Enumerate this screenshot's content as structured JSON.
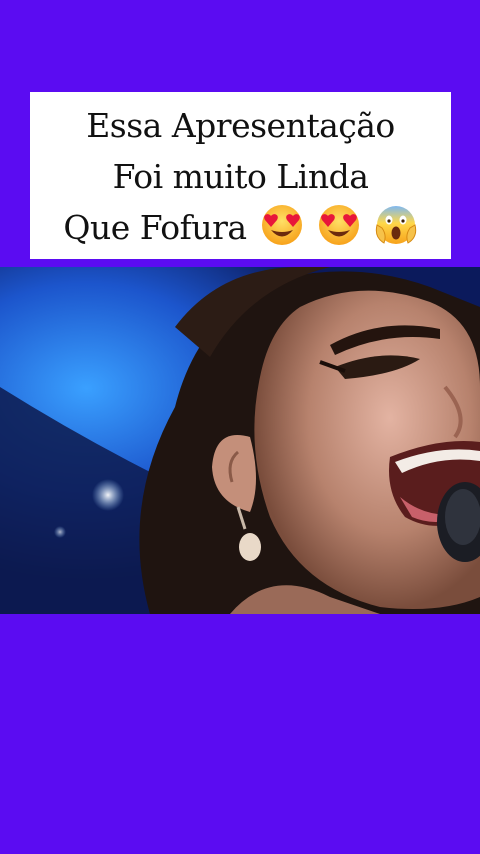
{
  "caption": {
    "line1": "Essa Apresentação",
    "line2": "Foi muito Linda",
    "line3": "Que Fofura",
    "emojis": [
      "heart-eyes-emoji",
      "heart-eyes-emoji",
      "screaming-face-emoji"
    ]
  },
  "colors": {
    "background": "#5b0cf2",
    "caption_bg": "#ffffff",
    "caption_text": "#111111"
  },
  "video": {
    "subject": "singer-with-microphone"
  }
}
